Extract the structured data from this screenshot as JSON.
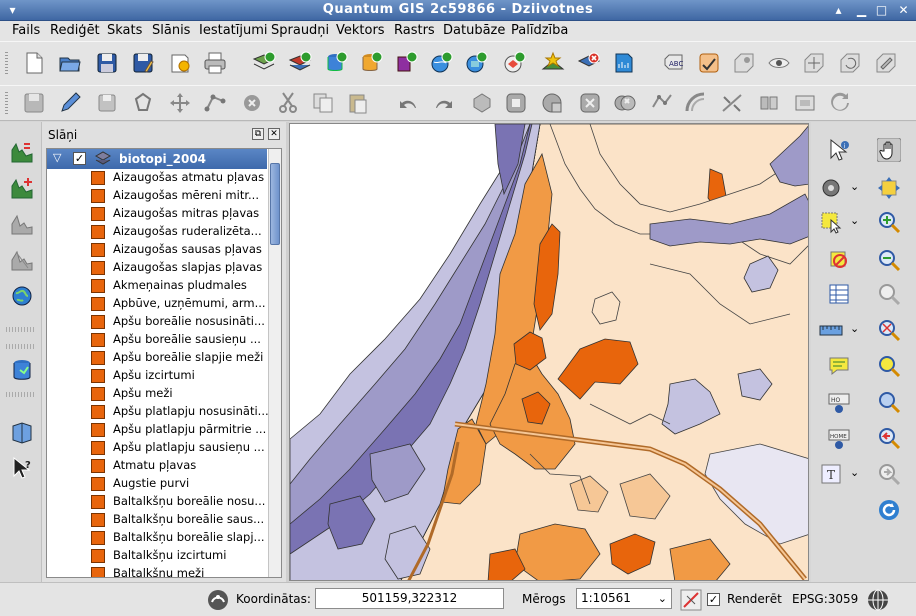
{
  "window": {
    "title": "Quantum GIS 2c59866 - Dziivotnes"
  },
  "menu": [
    "Fails",
    "Rediģēt",
    "Skats",
    "Slānis",
    "Iestatījumi",
    "Spraudņi",
    "Vektors",
    "Rastrs",
    "Datubāze",
    "Palīdzība"
  ],
  "layers_panel": {
    "title": "Slāņi",
    "layer": {
      "name": "biotopi_2004",
      "visible": true,
      "classes": [
        "Aizaugošas atmatu pļavas",
        "Aizaugošas mēreni mitr...",
        "Aizaugošas mitras pļavas",
        "Aizaugošas ruderalizēta...",
        "Aizaugošas sausas pļavas",
        "Aizaugošas slapjas pļavas",
        "Akmeņainas pludmales",
        "Apbūve, uzņēmumi, arm...",
        "Apšu boreālie nosusināti...",
        "Apšu boreālie sausieņu ...",
        "Apšu boreālie slapjie meži",
        "Apšu izcirtumi",
        "Apšu meži",
        "Apšu platlapju nosusināti...",
        "Apšu platlapju pārmitrie ...",
        "Apšu platlapju sausieņu ...",
        "Atmatu pļavas",
        "Augstie purvi",
        "Baltalkšņu boreālie nosu...",
        "Baltalkšņu boreālie saus...",
        "Baltalkšņu boreālie slapj...",
        "Baltalkšņu izcirtumi",
        "Baltalkšņu meži"
      ],
      "class_color": "#e8650c"
    }
  },
  "status": {
    "coord_label": "Koordinātas:",
    "coord_value": "501159,322312",
    "scale_label": "Mērogs",
    "scale_value": "1:10561",
    "render_label": "Renderēt",
    "render_checked": true,
    "crs": "EPSG:3059"
  },
  "colors": {
    "accent": "#3e69ab",
    "map_orange": "#e8650c",
    "map_light_orange": "#f19a45",
    "map_lavender": "#9e9ac8",
    "map_light_lavender": "#c4c2e0",
    "map_dark_purple": "#7a73b3",
    "map_peach": "#fbe3c8",
    "map_sandy": "#f6c796"
  }
}
